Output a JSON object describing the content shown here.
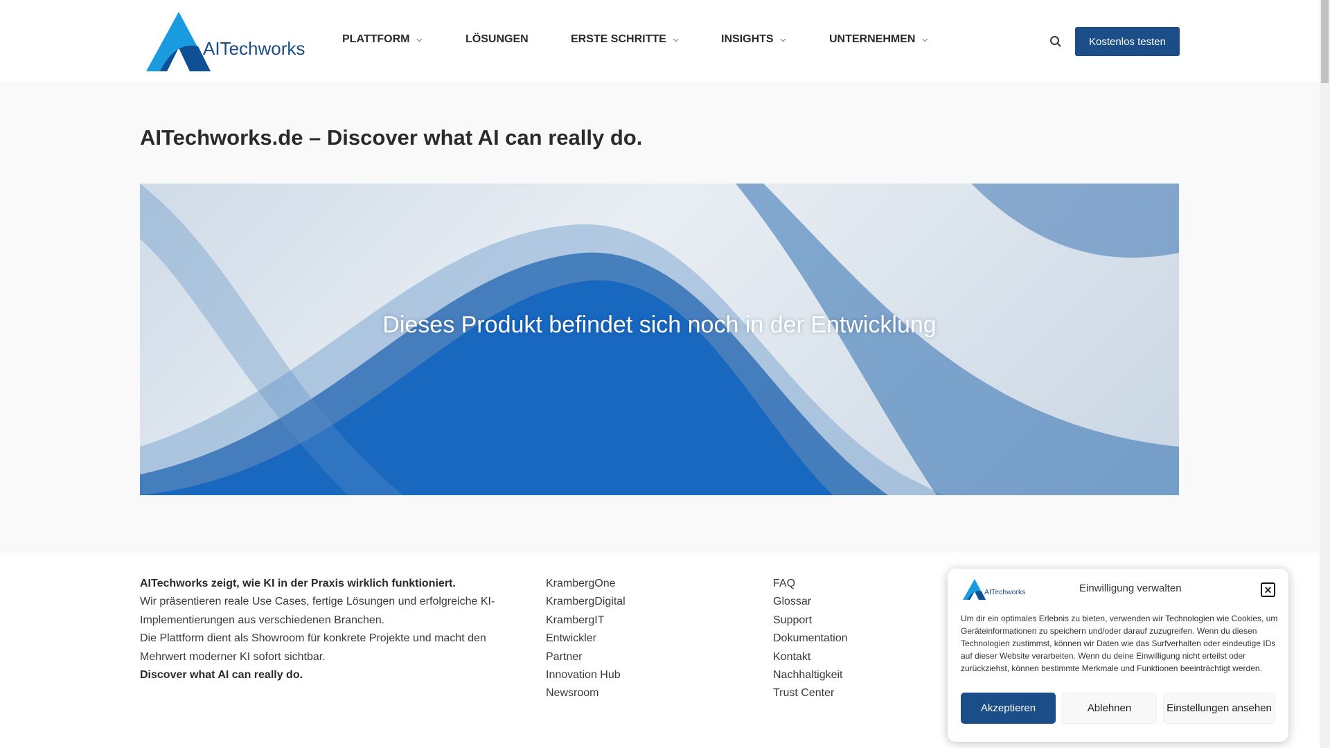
{
  "header": {
    "logo_text": "AITechworks",
    "nav": [
      {
        "label": "PLATTFORM",
        "dropdown": true
      },
      {
        "label": "LÖSUNGEN",
        "dropdown": false
      },
      {
        "label": "ERSTE SCHRITTE",
        "dropdown": true
      },
      {
        "label": "INSIGHTS",
        "dropdown": true
      },
      {
        "label": "UNTERNEHMEN",
        "dropdown": true
      }
    ],
    "cta": "Kostenlos testen"
  },
  "page": {
    "title": "AITechworks.de – Discover what AI can really do.",
    "banner_text": "Dieses Produkt befindet sich noch in der Entwicklung"
  },
  "footer": {
    "about": {
      "heading": "AITechworks zeigt, wie KI in der Praxis wirklich funktioniert.",
      "lines": [
        "Wir präsentieren reale Use Cases, fertige Lösungen und erfolgreiche KI-",
        "Implementierungen aus verschiedenen Branchen.",
        "Die Plattform dient als Showroom für konkrete Projekte und macht den",
        "Mehrwert moderner KI sofort sichtbar."
      ],
      "tagline": "Discover what AI can really do."
    },
    "links1": [
      "KrambergOne",
      "KrambergDigital",
      "KrambergIT",
      "Entwickler",
      "Partner",
      "Innovation Hub",
      "Newsroom"
    ],
    "links2": [
      "FAQ",
      "Glossar",
      "Support",
      "Dokumentation",
      "Kontakt",
      "Nachhaltigkeit",
      "Trust Center"
    ]
  },
  "cookie": {
    "logo_text": "AITechworks",
    "title": "Einwilligung verwalten",
    "text": "Um dir ein optimales Erlebnis zu bieten, verwenden wir Technologien wie Cookies, um Geräteinformationen zu speichern und/oder darauf zuzugreifen. Wenn du diesen Technologien zustimmst, können wir Daten wie das Surfverhalten oder eindeutige IDs auf dieser Website verarbeiten. Wenn du deine Einwilligung nicht erteilst oder zurückziehst, können bestimmte Merkmale und Funktionen beeinträchtigt werden.",
    "accept": "Akzeptieren",
    "deny": "Ablehnen",
    "settings": "Einstellungen ansehen"
  },
  "colors": {
    "brand": "#1b4e88",
    "accent": "#1a9be0"
  }
}
